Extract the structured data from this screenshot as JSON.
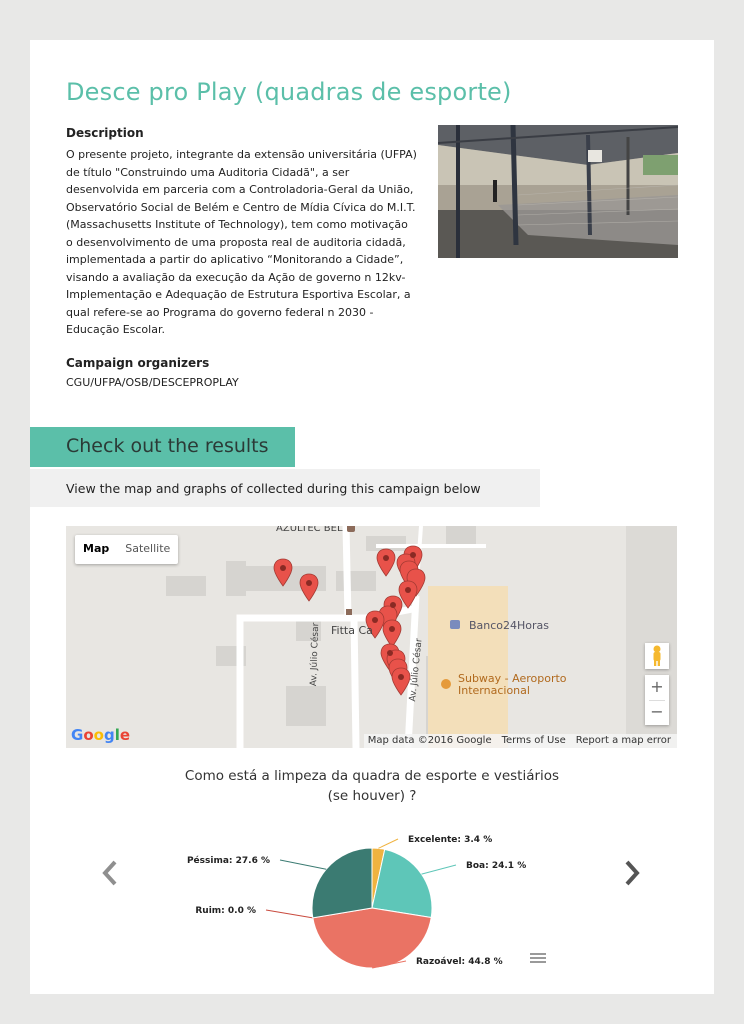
{
  "campaign": {
    "title": "Desce pro Play (quadras de esporte)",
    "description_heading": "Description",
    "description": "O presente projeto, integrante da extensão universitária (UFPA) de título \"Construindo uma Auditoria Cidadã\", a ser desenvolvida em parceria com a Controladoria-Geral da União, Observatório Social de Belém e Centro de Mídia Cívica do M.I.T. (Massachusetts Institute of Technology), tem como motivação o desenvolvimento de uma proposta real de auditoria cidadã, implementada a partir do aplicativo “Monitorando a Cidade”, visando a avaliação da execução da Ação de governo n 12kv- Implementação e Adequação de Estrutura Esportiva Escolar, a qual refere-se ao Programa do governo federal n 2030 - Educação Escolar.",
    "organizers_heading": "Campaign organizers",
    "organizers": "CGU/UFPA/OSB/DESCEPROPLAY"
  },
  "results": {
    "heading": "Check out the results",
    "subheading": "View the map and graphs of collected during this campaign below"
  },
  "map": {
    "type_buttons": [
      "Map",
      "Satellite"
    ],
    "active_type": "Map",
    "labels": {
      "poi_top": "AZULTEC BEL",
      "fitta": "Fitta Ca",
      "atm": "Banco24Horas",
      "subway_1": "Subway - Aeroporto",
      "subway_2": "Internacional",
      "street_1": "Av. Júlio César",
      "street_2": "Av. Júlio César"
    },
    "zoom_in": "+",
    "zoom_out": "−",
    "google_logo": "Google",
    "footer": {
      "map_data": "Map data ©2016 Google",
      "terms": "Terms of Use",
      "report": "Report a map error"
    },
    "marker_color": "#e8524a"
  },
  "chart_data": {
    "type": "pie",
    "title_line1": "Como está a limpeza da quadra de esporte e vestiários",
    "title_line2": "(se houver) ?",
    "slices": [
      {
        "name": "Excelente",
        "value": 3.4,
        "label": "Excelente: 3.4 %",
        "color": "#f0b340"
      },
      {
        "name": "Boa",
        "value": 24.1,
        "label": "Boa: 24.1 %",
        "color": "#5ec6b8"
      },
      {
        "name": "Razoável",
        "value": 44.8,
        "label": "Razoável: 44.8 %",
        "color": "#ea7364"
      },
      {
        "name": "Ruim",
        "value": 0.0,
        "label": "Ruim: 0.0 %",
        "color": "#c94a3e"
      },
      {
        "name": "Péssima",
        "value": 27.6,
        "label": "Péssima: 27.6 %",
        "color": "#3b7b72"
      }
    ]
  }
}
